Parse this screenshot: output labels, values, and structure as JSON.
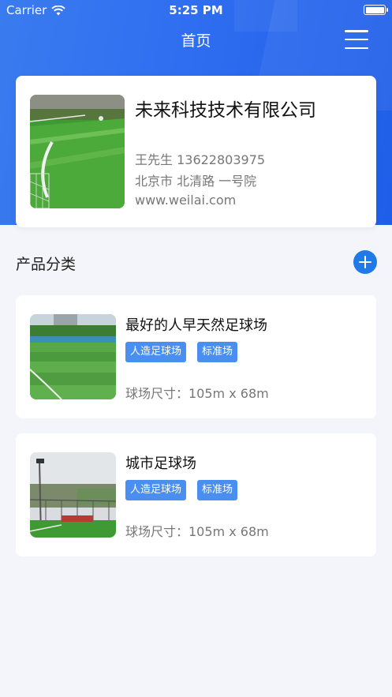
{
  "status_bar": {
    "carrier": "Carrier",
    "time": "5:25 PM"
  },
  "nav": {
    "title": "首页"
  },
  "company": {
    "name": "未来科技技术有限公司",
    "contact": "王先生 13622803975",
    "address": "北京市 北清路 一号院",
    "website": "www.weilai.com"
  },
  "section": {
    "title": "产品分类"
  },
  "products": [
    {
      "title": "最好的人早天然足球场",
      "tags": [
        "人造足球场",
        "标准场"
      ],
      "size": "球场尺寸：105m x 68m"
    },
    {
      "title": "城市足球场",
      "tags": [
        "人造足球场",
        "标准场"
      ],
      "size": "球场尺寸：105m x 68m"
    }
  ],
  "colors": {
    "primary": "#2f6ef0",
    "tag": "#4a8ff0",
    "add_button": "#1f7ae8",
    "background": "#f3f5fa"
  },
  "icons": [
    "wifi-icon",
    "battery-icon",
    "menu-icon",
    "add-icon"
  ]
}
